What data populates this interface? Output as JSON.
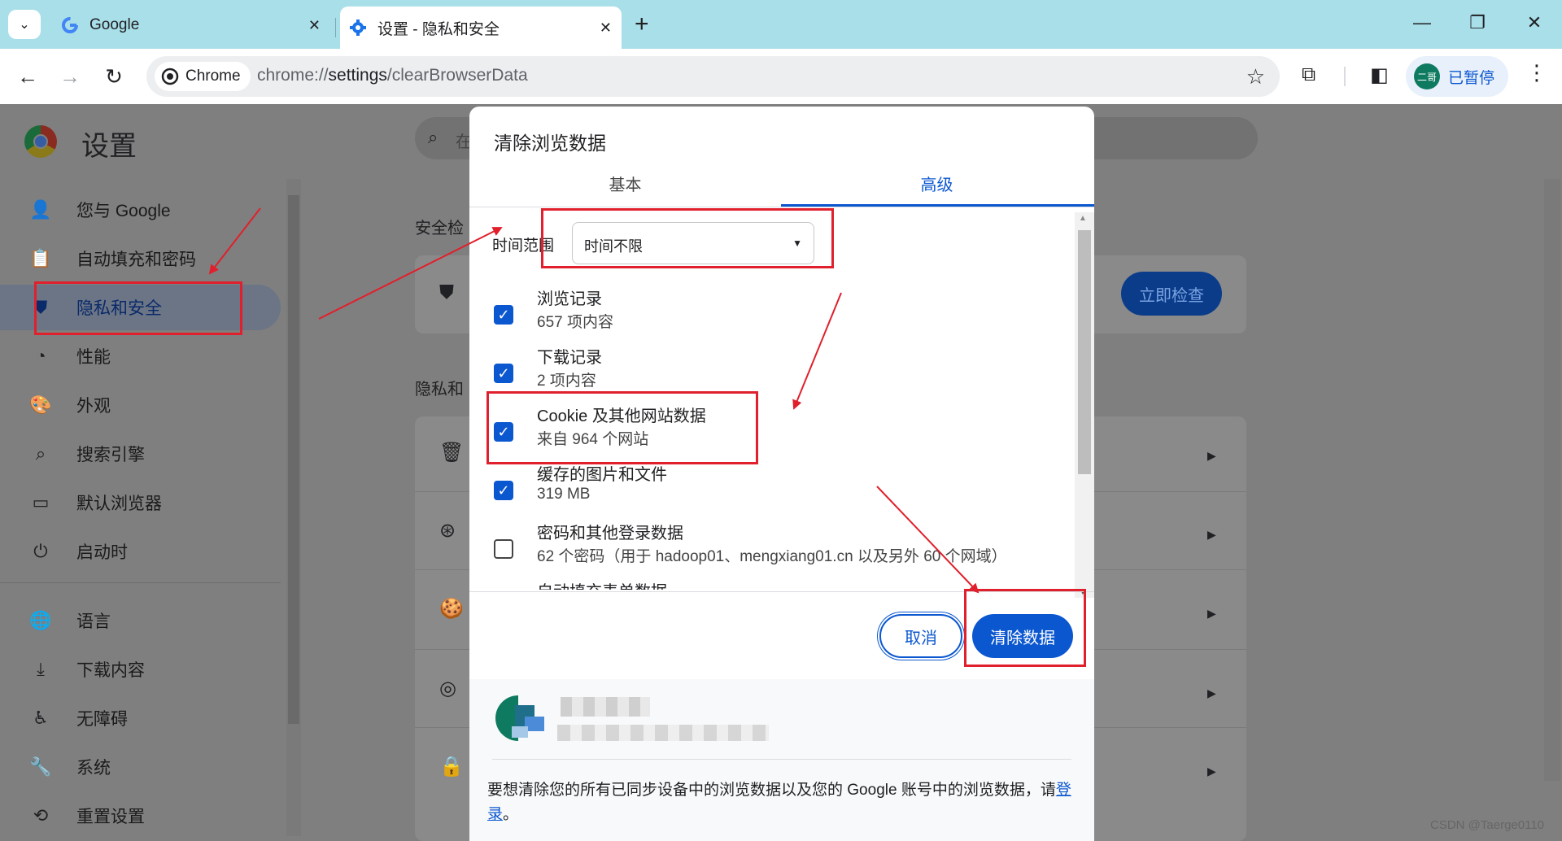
{
  "tabs": [
    {
      "title": "Google",
      "active": false
    },
    {
      "title": "设置 - 隐私和安全",
      "active": true
    }
  ],
  "toolbar": {
    "chip_label": "Chrome",
    "url_prefix": "chrome://",
    "url_bold": "settings",
    "url_rest": "/clearBrowserData",
    "profile_avatar": "二哥",
    "profile_label": "已暂停"
  },
  "settings": {
    "title": "设置",
    "search_placeholder": "在",
    "nav": [
      {
        "label": "您与 Google",
        "icon": "person-icon"
      },
      {
        "label": "自动填充和密码",
        "icon": "clipboard-icon"
      },
      {
        "label": "隐私和安全",
        "icon": "shield-icon",
        "selected": true
      },
      {
        "label": "性能",
        "icon": "gauge-icon"
      },
      {
        "label": "外观",
        "icon": "palette-icon"
      },
      {
        "label": "搜索引擎",
        "icon": "search-icon"
      },
      {
        "label": "默认浏览器",
        "icon": "browser-icon"
      },
      {
        "label": "启动时",
        "icon": "power-icon"
      },
      {
        "label": "语言",
        "icon": "globe-icon"
      },
      {
        "label": "下载内容",
        "icon": "download-icon"
      },
      {
        "label": "无障碍",
        "icon": "accessibility-icon"
      },
      {
        "label": "系统",
        "icon": "wrench-icon"
      },
      {
        "label": "重置设置",
        "icon": "history-icon"
      }
    ],
    "section_safety": "安全检",
    "section_privacy": "隐私和",
    "check_now": "立即检查"
  },
  "dialog": {
    "title": "清除浏览数据",
    "tab_basic": "基本",
    "tab_advanced": "高级",
    "range_label": "时间范围",
    "range_value": "时间不限",
    "items": [
      {
        "title": "浏览记录",
        "sub": "657 项内容",
        "checked": true
      },
      {
        "title": "下载记录",
        "sub": "2 项内容",
        "checked": true
      },
      {
        "title": "Cookie 及其他网站数据",
        "sub": "来自 964 个网站",
        "checked": true
      },
      {
        "title": "缓存的图片和文件",
        "sub": "319 MB",
        "checked": true
      },
      {
        "title": "密码和其他登录数据",
        "sub": "62 个密码（用于 hadoop01、mengxiang01.cn 以及另外 60 个网域）",
        "checked": false
      },
      {
        "title": "自动填充表单数据",
        "sub": "",
        "checked": false
      }
    ],
    "cancel": "取消",
    "clear": "清除数据",
    "sync_text": "要想清除您的所有已同步设备中的浏览数据以及您的 Google 账号中的浏览数据，请",
    "sync_link": "登录",
    "sync_end": "。"
  },
  "watermark": "CSDN @Taerge0110",
  "colors": {
    "accent": "#0b57d0",
    "annotation": "#e0202c",
    "tabstrip": "#a9dfe9"
  }
}
